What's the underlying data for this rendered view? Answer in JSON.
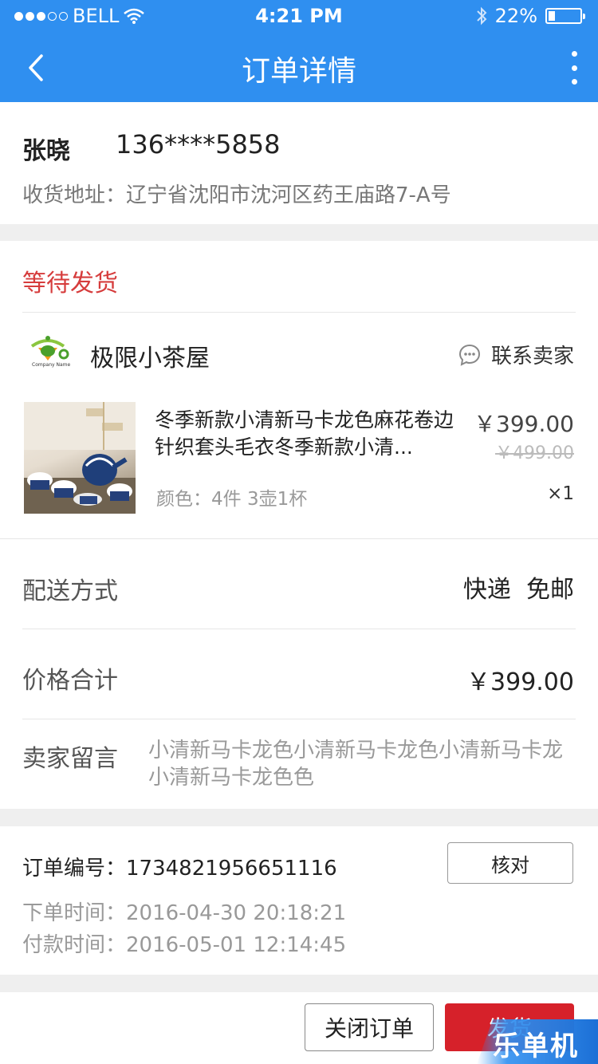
{
  "status_bar": {
    "carrier": "BELL",
    "time": "4:21 PM",
    "battery": "22%",
    "battery_level": 0.22,
    "signal_strength": 3,
    "icons": [
      "wifi-icon",
      "bluetooth-icon",
      "battery-icon"
    ]
  },
  "nav": {
    "title": "订单详情",
    "icons": [
      "back-arrow-icon",
      "more-vertical-icon"
    ]
  },
  "receiver": {
    "name": "张晓",
    "phone": "136****5858",
    "address": "收货地址：辽宁省沈阳市沈河区药王庙路7-A号"
  },
  "order": {
    "status": "等待发货",
    "status_color": "#d63c3c",
    "shop": {
      "name": "极限小茶屋",
      "logo_text": "Company Name",
      "contact_label": "联系卖家"
    },
    "item": {
      "title": "冬季新款小清新马卡龙色麻花卷边针织套头毛衣冬季新款小清...",
      "price": "￥399.00",
      "original_price": "￥499.00",
      "spec": "颜色：4件 3壶1杯",
      "quantity": "×1"
    },
    "delivery": {
      "label": "配送方式",
      "value": "快递  免邮"
    },
    "total": {
      "label": "价格合计",
      "value": "￥399.00"
    },
    "message": {
      "label": "卖家留言",
      "value": "小清新马卡龙色小清新马卡龙色小清新马卡龙小清新马卡龙色色"
    }
  },
  "order_info": {
    "order_no": "订单编号：1734821956651116",
    "verify_label": "核对",
    "created": "下单时间：2016-04-30  20:18:21",
    "paid": "付款时间：2016-05-01  12:14:45"
  },
  "footer": {
    "close_label": "关闭订单",
    "ship_label": "发货"
  },
  "watermark": {
    "text": "乐单机"
  },
  "colors": {
    "brand_blue": "#2f8ff0",
    "action_red": "#d6212a",
    "background": "#efefef"
  }
}
